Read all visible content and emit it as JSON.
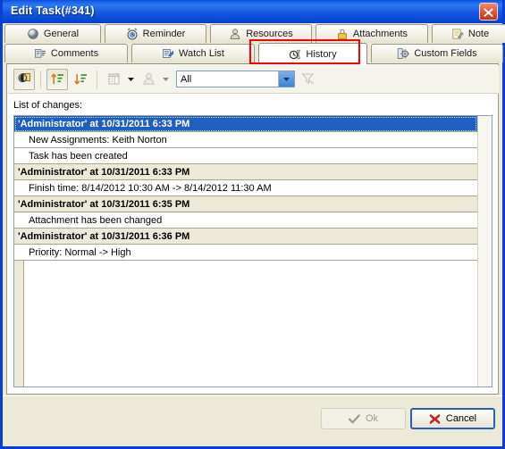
{
  "window": {
    "title": "Edit Task(#341)",
    "close_icon": "close-icon",
    "titlebar_color": "#1557e0",
    "close_button_color": "#c4331a"
  },
  "tabs": {
    "row1": [
      {
        "label": "General",
        "icon": "sphere-icon",
        "active": false
      },
      {
        "label": "Reminder",
        "icon": "alarm-clock-icon",
        "active": false
      },
      {
        "label": "Resources",
        "icon": "person-icon",
        "active": false
      },
      {
        "label": "Attachments",
        "icon": "paperclip-icon",
        "active": false
      },
      {
        "label": "Note",
        "icon": "note-pen-icon",
        "active": false
      }
    ],
    "row2": [
      {
        "label": "Comments",
        "icon": "comments-icon",
        "active": false
      },
      {
        "label": "Watch List",
        "icon": "watch-list-icon",
        "active": false
      },
      {
        "label": "History",
        "icon": "history-clock-icon",
        "active": true
      },
      {
        "label": "Custom Fields",
        "icon": "gear-icon",
        "active": false
      }
    ],
    "highlight_color": "#fd0000"
  },
  "toolbar": {
    "buttons": [
      {
        "name": "toggle-view-button",
        "icon": "window-overlay-icon",
        "pressed": true,
        "disabled": false
      },
      {
        "name": "sort-ascending-button",
        "icon": "sort-ascending-icon",
        "pressed": true,
        "disabled": false
      },
      {
        "name": "sort-descending-button",
        "icon": "sort-descending-icon",
        "pressed": false,
        "disabled": false
      },
      {
        "name": "columns-button",
        "icon": "columns-icon",
        "pressed": false,
        "disabled": true
      },
      {
        "name": "user-filter-button",
        "icon": "person-icon",
        "pressed": false,
        "disabled": true
      }
    ],
    "filter_combo": {
      "value": "All",
      "placeholder": "All",
      "arrow_icon": "chevron-down-icon",
      "options": [
        "All"
      ]
    },
    "filter_funnel": {
      "name": "filter-funnel-button",
      "icon": "funnel-icon",
      "disabled": true
    }
  },
  "content": {
    "list_label": "List of changes:",
    "rows": [
      {
        "type": "group",
        "text": "'Administrator' at 10/31/2011 6:33 PM",
        "selected": true
      },
      {
        "type": "child",
        "text": "New Assignments: Keith Norton",
        "selected": false
      },
      {
        "type": "child",
        "text": "Task has been created",
        "selected": false
      },
      {
        "type": "group",
        "text": "'Administrator' at 10/31/2011 6:33 PM",
        "selected": false
      },
      {
        "type": "child",
        "text": "Finish time: 8/14/2012 10:30 AM -> 8/14/2012 11:30 AM",
        "selected": false
      },
      {
        "type": "group",
        "text": "'Administrator' at 10/31/2011 6:35 PM",
        "selected": false
      },
      {
        "type": "child",
        "text": "Attachment has been changed",
        "selected": false
      },
      {
        "type": "group",
        "text": "'Administrator' at 10/31/2011 6:36 PM",
        "selected": false
      },
      {
        "type": "child",
        "text": "Priority: Normal -> High",
        "selected": false
      }
    ],
    "selection_color": "#1e5fc0",
    "group_row_color": "#ece9d8"
  },
  "footer": {
    "ok": {
      "label": "Ok",
      "icon": "check-icon",
      "disabled": true
    },
    "cancel": {
      "label": "Cancel",
      "icon": "x-red-icon",
      "disabled": false,
      "default": true
    }
  }
}
